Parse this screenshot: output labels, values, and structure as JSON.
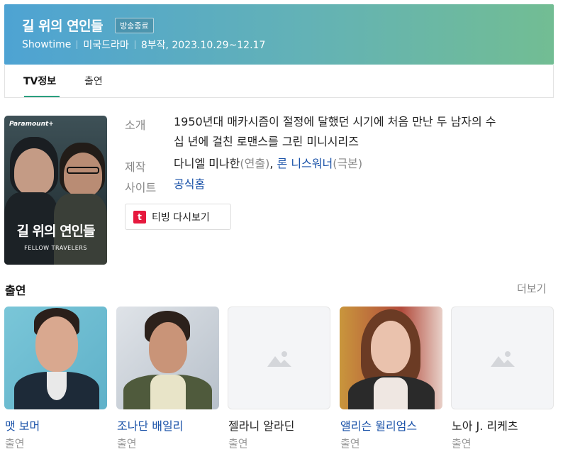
{
  "header": {
    "title": "길 위의 연인들",
    "status_badge": "방송종료",
    "network": "Showtime",
    "genre": "미국드라마",
    "episodes_dates": "8부작, 2023.10.29~12.17"
  },
  "tabs": [
    {
      "label": "TV정보",
      "active": true
    },
    {
      "label": "출연",
      "active": false
    }
  ],
  "poster": {
    "brand": "Paramount+",
    "title": "길 위의 연인들",
    "subtitle": "FELLOW TRAVELERS"
  },
  "info": {
    "intro_label": "소개",
    "intro_line1": "1950년대 매카시즘이 절정에 달했던 시기에 처음 만난 두 남자의 수",
    "intro_line2": "십 년에 걸친 로맨스를 그린 미니시리즈",
    "production_label": "제작",
    "director": "다니엘 미나한",
    "director_role": "(연출)",
    "separator": ", ",
    "writer": "론 니스워너",
    "writer_role": "(극본)",
    "site_label": "사이트",
    "site_link": "공식홈"
  },
  "tving_button": {
    "label": "티빙 다시보기",
    "logo_letter": "t"
  },
  "cast_section": {
    "title": "출연",
    "more": "더보기",
    "members": [
      {
        "name": "맷 보머",
        "role": "출연",
        "has_photo": true
      },
      {
        "name": "조나단 배일리",
        "role": "출연",
        "has_photo": true
      },
      {
        "name": "젤라니 알라딘",
        "role": "출연",
        "has_photo": false
      },
      {
        "name": "앨리슨 윌리엄스",
        "role": "출연",
        "has_photo": true
      },
      {
        "name": "노아 J. 리케츠",
        "role": "출연",
        "has_photo": false
      }
    ]
  },
  "colors": {
    "header_gradient_start": "#4ea3d3",
    "header_gradient_end": "#72bd93",
    "tab_underline": "#2a9f7e",
    "link": "#1a52a8",
    "tving_red": "#e6193e"
  }
}
